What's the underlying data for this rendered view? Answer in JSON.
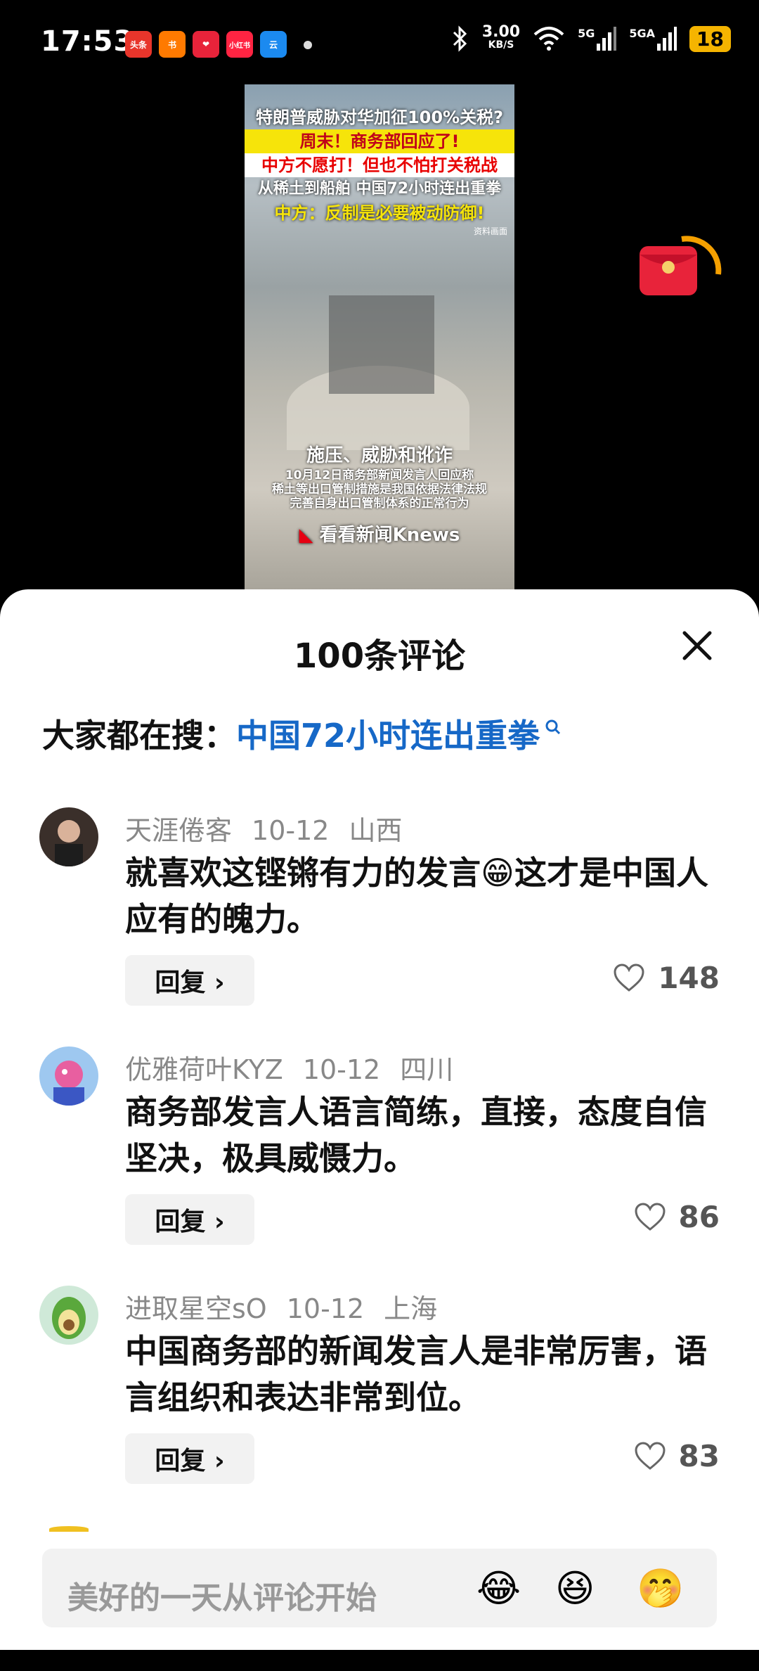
{
  "status_bar": {
    "time": "17:53",
    "app_badges": [
      {
        "label": "头条",
        "color": "#e8352b"
      },
      {
        "label": "书",
        "color": "#ff7a00"
      },
      {
        "label": "❤",
        "color": "#e8233a"
      },
      {
        "label": "小红书",
        "color": "#ff2442"
      },
      {
        "label": "云",
        "color": "#1b8af0"
      }
    ],
    "net_speed_value": "3.00",
    "net_speed_unit": "KB/S",
    "signal_labels": [
      "5G",
      "5GA"
    ],
    "battery": "18"
  },
  "video": {
    "headline_lines": [
      "特朗普威胁对华加征100%关税?",
      "周末！商务部回应了!",
      "中方不愿打！但也不怕打关税战",
      "从稀土到船舶  中国72小时连出重拳",
      "中方：反制是必要被动防御!"
    ],
    "source_note": "资料画面",
    "caption_title": "施压、威胁和讹诈",
    "caption_lines": [
      "10月12日商务部新闻发言人回应称",
      "稀土等出口管制措施是我国依据法律法规",
      "完善自身出口管制体系的正常行为"
    ],
    "brand": "看看新闻Knews"
  },
  "comments_sheet": {
    "title": "100条评论",
    "search_prefix": "大家都在搜：",
    "search_link": "中国72小时连出重拳",
    "comments": [
      {
        "user": "天涯倦客",
        "date": "10-12",
        "region": "山西",
        "text": "就喜欢这铿锵有力的发言😁这才是中国人应有的魄力。",
        "reply_label": "回复 ›",
        "likes": "148"
      },
      {
        "user": "优雅荷叶KYZ",
        "date": "10-12",
        "region": "四川",
        "text": "商务部发言人语言简练，直接，态度自信坚决，极具威慑力。",
        "reply_label": "回复 ›",
        "likes": "86"
      },
      {
        "user": "进取星空sO",
        "date": "10-12",
        "region": "上海",
        "text": "中国商务部的新闻发言人是非常厉害，语言组织和表达非常到位。",
        "reply_label": "回复 ›",
        "likes": "83"
      }
    ],
    "input_placeholder": "美好的一天从评论开始",
    "emojis": [
      "😂",
      "😆",
      "🤭"
    ]
  },
  "colors": {
    "link": "#1668c7",
    "battery": "#f5b400",
    "red_packet": "#e8233a"
  }
}
